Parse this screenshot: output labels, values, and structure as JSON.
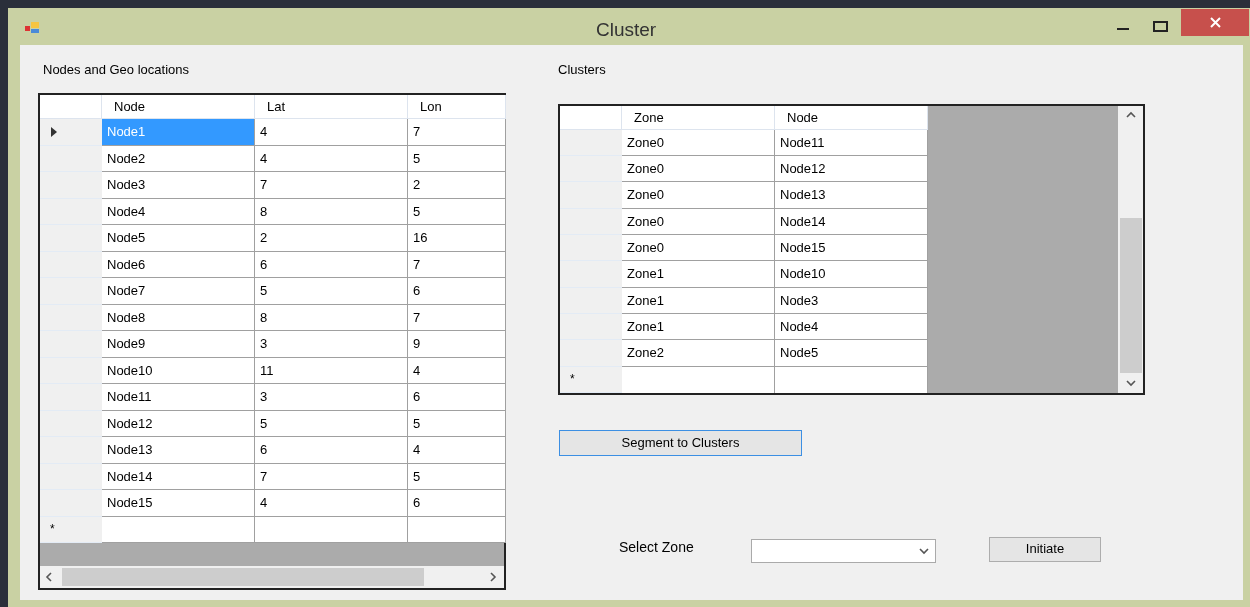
{
  "window": {
    "title": "Cluster"
  },
  "nodes_panel": {
    "label": "Nodes and Geo locations",
    "columns": [
      "Node",
      "Lat",
      "Lon"
    ],
    "rows": [
      {
        "cells": [
          "Node1",
          "4",
          "7"
        ],
        "selected": true
      },
      {
        "cells": [
          "Node2",
          "4",
          "5"
        ],
        "selected": false
      },
      {
        "cells": [
          "Node3",
          "7",
          "2"
        ],
        "selected": false
      },
      {
        "cells": [
          "Node4",
          "8",
          "5"
        ],
        "selected": false
      },
      {
        "cells": [
          "Node5",
          "2",
          "16"
        ],
        "selected": false
      },
      {
        "cells": [
          "Node6",
          "6",
          "7"
        ],
        "selected": false
      },
      {
        "cells": [
          "Node7",
          "5",
          "6"
        ],
        "selected": false
      },
      {
        "cells": [
          "Node8",
          "8",
          "7"
        ],
        "selected": false
      },
      {
        "cells": [
          "Node9",
          "3",
          "9"
        ],
        "selected": false
      },
      {
        "cells": [
          "Node10",
          "11",
          "4"
        ],
        "selected": false
      },
      {
        "cells": [
          "Node11",
          "3",
          "6"
        ],
        "selected": false
      },
      {
        "cells": [
          "Node12",
          "5",
          "5"
        ],
        "selected": false
      },
      {
        "cells": [
          "Node13",
          "6",
          "4"
        ],
        "selected": false
      },
      {
        "cells": [
          "Node14",
          "7",
          "5"
        ],
        "selected": false
      },
      {
        "cells": [
          "Node15",
          "4",
          "6"
        ],
        "selected": false
      }
    ],
    "new_row_marker": "*"
  },
  "clusters_panel": {
    "label": "Clusters",
    "columns": [
      "Zone",
      "Node"
    ],
    "rows": [
      {
        "cells": [
          "Zone0",
          "Node11"
        ],
        "selected": false
      },
      {
        "cells": [
          "Zone0",
          "Node12"
        ],
        "selected": false
      },
      {
        "cells": [
          "Zone0",
          "Node13"
        ],
        "selected": false
      },
      {
        "cells": [
          "Zone0",
          "Node14"
        ],
        "selected": false
      },
      {
        "cells": [
          "Zone0",
          "Node15"
        ],
        "selected": false
      },
      {
        "cells": [
          "Zone1",
          "Node10"
        ],
        "selected": false
      },
      {
        "cells": [
          "Zone1",
          "Node3"
        ],
        "selected": false
      },
      {
        "cells": [
          "Zone1",
          "Node4"
        ],
        "selected": false
      },
      {
        "cells": [
          "Zone2",
          "Node5"
        ],
        "selected": false
      }
    ],
    "new_row_marker": "*"
  },
  "segment_button": {
    "label": "Segment to Clusters",
    "focused": true
  },
  "select_zone": {
    "label": "Select Zone"
  },
  "initiate_button": {
    "label": "Initiate"
  }
}
